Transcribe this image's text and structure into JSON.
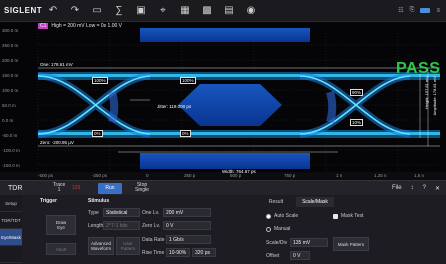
{
  "toolbar": {
    "brand": "SIGLENT",
    "icons": [
      "undo-icon",
      "redo-icon",
      "measure-icon",
      "math-icon",
      "display-icon",
      "cursor-icon",
      "analysis-icon",
      "save-icon",
      "print-icon",
      "camera-icon"
    ],
    "right_icons": [
      "channel-icon",
      "usb-icon",
      "lan-icon",
      "battery-icon"
    ]
  },
  "scope": {
    "channel_tag": "C1",
    "channel_info": "High = 200 mV  Low = 0s  1.00 V",
    "pass_label": "PASS",
    "y_labels": [
      "300.0 m",
      "250.0 m",
      "200.0 m",
      "150.0 m",
      "100.0 m",
      "50.0 m",
      "0.0 m",
      "-50.0 m",
      "-100.0 m",
      "-150.0 m"
    ],
    "x_labels": [
      "-500 ps",
      "-250 ps",
      "0",
      "250 p",
      "500 p",
      "750 p",
      "1 n",
      "1.25 n",
      "1.5 n"
    ],
    "one_label": "One: 178.61 mV",
    "zero_label": "Zero: -200.95 µV",
    "jitter_label": "Jitter: 119.000 ps",
    "width_label": "Width: 764.67 ps",
    "tags": [
      "100%",
      "100%",
      "0%",
      "0%",
      "90%",
      "10%"
    ],
    "height_label": "Height: 157.81 mV",
    "amplitude_label": "Amplitude: 178.81 mV"
  },
  "panel": {
    "title": "TDR",
    "trace_label": "Trace\n1",
    "trace_value": "123",
    "run_label": "Run",
    "stop_label": "Stop\nSingle",
    "right_tabs": [
      "File",
      "↕",
      "?",
      "✕"
    ],
    "side_items": [
      "Setup",
      "TDR/TDT",
      "Eye/Mask",
      ""
    ],
    "trigger_title": "Trigger",
    "trigger_button": "Draw\nEye",
    "abort_label": "Abort",
    "stimulus_title": "Stimulus",
    "type_label": "Type",
    "type_value": "Statistical",
    "length_label": "Length",
    "length_value": "2^7-1 bits",
    "one_lv_label": "One Lv.",
    "one_lv_value": "200 mV",
    "zero_lv_label": "Zero Lv.",
    "zero_lv_value": "0 V",
    "advanced_label": "Advanced\nWaveform",
    "user_pattern_label": "User\nPattern",
    "data_rate_label": "Data Rate",
    "data_rate_value": "1 Gb/s",
    "rise_time_label": "Rise Time",
    "rise_time_value": "10-90%",
    "rise_time_ps": "320 ps",
    "result_tab": "Result",
    "scale_tab": "Scale/Mask",
    "auto_scale": "Auto Scale",
    "manual": "Manual",
    "mask_test": "Mask Test",
    "scale_label": "Scale/Div",
    "scale_value": "135 mV",
    "offset_label": "Offset",
    "offset_value": "0 V",
    "mask_pattern": "Mask Pattern"
  }
}
